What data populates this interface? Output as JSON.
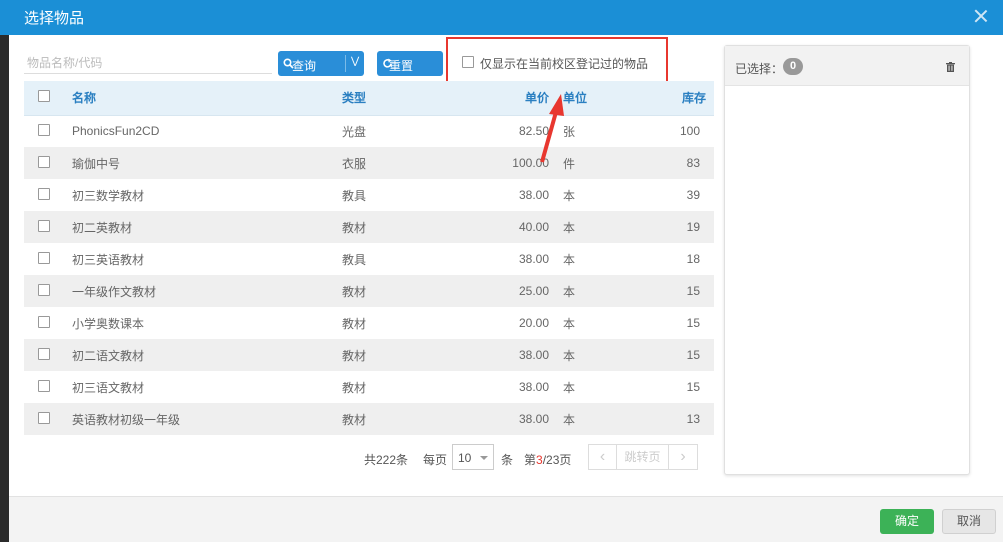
{
  "dialog": {
    "title": "选择物品"
  },
  "search": {
    "placeholder": "物品名称/代码",
    "query_label": "查询",
    "reset_label": "重置"
  },
  "filter": {
    "label": "仅显示在当前校区登记过的物品",
    "checked": false
  },
  "table": {
    "headers": {
      "name": "名称",
      "type": "类型",
      "price": "单价",
      "unit": "单位",
      "stock": "库存"
    },
    "rows": [
      {
        "name": "PhonicsFun2CD",
        "type": "光盘",
        "price": "82.50",
        "unit": "张",
        "stock": "100"
      },
      {
        "name": "瑜伽中号",
        "type": "衣服",
        "price": "100.00",
        "unit": "件",
        "stock": "83"
      },
      {
        "name": "初三数学教材",
        "type": "教具",
        "price": "38.00",
        "unit": "本",
        "stock": "39"
      },
      {
        "name": "初二英教材",
        "type": "教材",
        "price": "40.00",
        "unit": "本",
        "stock": "19"
      },
      {
        "name": "初三英语教材",
        "type": "教具",
        "price": "38.00",
        "unit": "本",
        "stock": "18"
      },
      {
        "name": "一年级作文教材",
        "type": "教材",
        "price": "25.00",
        "unit": "本",
        "stock": "15"
      },
      {
        "name": "小学奥数课本",
        "type": "教材",
        "price": "20.00",
        "unit": "本",
        "stock": "15"
      },
      {
        "name": "初二语文教材",
        "type": "教材",
        "price": "38.00",
        "unit": "本",
        "stock": "15"
      },
      {
        "name": "初三语文教材",
        "type": "教材",
        "price": "38.00",
        "unit": "本",
        "stock": "15"
      },
      {
        "name": "英语教材初级一年级",
        "type": "教材",
        "price": "38.00",
        "unit": "本",
        "stock": "13"
      }
    ]
  },
  "pager": {
    "total": "共222条",
    "per_page_label": "每页",
    "per_page_value": "10",
    "per_page_unit": "条",
    "page_prefix": "第",
    "current": "3",
    "page_suffix": "/23页",
    "jump_label": "跳转页",
    "prev": "‹",
    "next": "›"
  },
  "selected": {
    "label": "已选择：",
    "count": "0"
  },
  "footer": {
    "ok": "确定",
    "cancel": "取消"
  },
  "colors": {
    "titlebar": "#1b8fd6",
    "primary": "#2a8ed8",
    "ok": "#3cb257",
    "highlight": "#e8372f"
  }
}
